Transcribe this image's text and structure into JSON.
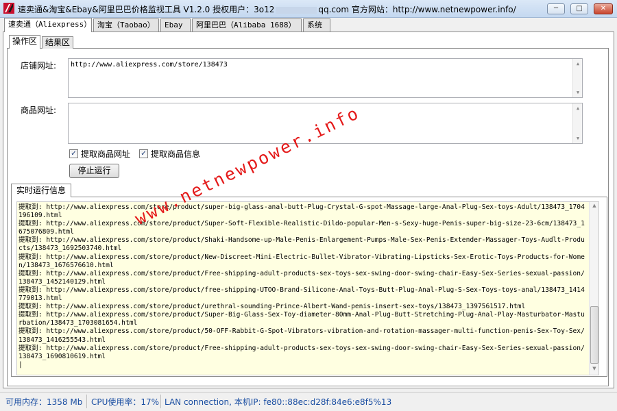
{
  "window": {
    "title_prefix": "速卖通&淘宝&Ebay&阿里巴巴价格监视工具 V1.2.0 授权用户：",
    "title_user_visible": "3o12",
    "title_user_suffix": "qq.com",
    "title_site": "官方网站：http://www.netnewpower.info/",
    "min_label": "─",
    "max_label": "□",
    "close_label": "✕"
  },
  "tabs": [
    {
      "label": "速卖通（Aliexpress）",
      "active": true
    },
    {
      "label": "淘宝（Taobao）"
    },
    {
      "label": "Ebay"
    },
    {
      "label": "阿里巴巴（Alibaba 1688）"
    },
    {
      "label": "系统"
    }
  ],
  "subtabs": [
    {
      "label": "操作区",
      "active": true
    },
    {
      "label": "结果区"
    }
  ],
  "form": {
    "shop_url_label": "店铺网址:",
    "shop_url_value": "http://www.aliexpress.com/store/138473",
    "product_url_label": "商品网址:",
    "product_url_value": "",
    "check_product_url_label": "提取商品网址",
    "check_product_info_label": "提取商品信息",
    "stop_button": "停止运行"
  },
  "log": {
    "title": "实时运行信息",
    "lines": [
      "提取到: http://www.aliexpress.com/store/product/super-big-glass-anal-butt-Plug-Crystal-G-spot-Massage-large-Anal-Plug-Sex-toys-Adult/138473_1704196109.html",
      "提取到: http://www.aliexpress.com/store/product/Super-Soft-Flexible-Realistic-Dildo-popular-Men-s-Sexy-huge-Penis-super-big-size-23-6cm/138473_1675076809.html",
      "提取到: http://www.aliexpress.com/store/product/Shaki-Handsome-up-Male-Penis-Enlargement-Pumps-Male-Sex-Penis-Extender-Massager-Toys-Audlt-Products/138473_1692503740.html",
      "提取到: http://www.aliexpress.com/store/product/New-Discreet-Mini-Electric-Bullet-Vibrator-Vibrating-Lipsticks-Sex-Erotic-Toys-Products-for-Women/138473_1676576610.html",
      "提取到: http://www.aliexpress.com/store/product/Free-shipping-adult-products-sex-toys-sex-swing-door-swing-chair-Easy-Sex-Series-sexual-passion/138473_1452140129.html",
      "提取到: http://www.aliexpress.com/store/product/free-shipping-UTOO-Brand-Silicone-Anal-Toys-Butt-Plug-Anal-Plug-S-Sex-Toys-toys-anal/138473_1414779013.html",
      "提取到: http://www.aliexpress.com/store/product/urethral-sounding-Prince-Albert-Wand-penis-insert-sex-toys/138473_1397561517.html",
      "提取到: http://www.aliexpress.com/store/product/Super-Big-Glass-Sex-Toy-diameter-80mm-Anal-Plug-Butt-Stretching-Plug-Anal-Play-Masturbator-Masturbation/138473_1703081654.html",
      "提取到: http://www.aliexpress.com/store/product/50-OFF-Rabbit-G-Spot-Vibrators-vibration-and-rotation-massager-multi-function-penis-Sex-Toy-Sex/138473_1416255543.html",
      "提取到: http://www.aliexpress.com/store/product/Free-shipping-adult-products-sex-toys-sex-swing-door-swing-chair-Easy-Sex-Series-sexual-passion/138473_1690810619.html"
    ]
  },
  "watermark": "www.netnewpower.info",
  "status": {
    "memory": "可用内存：1358 Mb",
    "cpu": "CPU使用率：17%",
    "network": "LAN connection,  本机IP: fe80::88ec:d28f:84e6:e8f5%13"
  },
  "colors": {
    "log_bg": "#ffffe1",
    "status_text": "#1a4ea2",
    "watermark": "#e41a1a"
  }
}
